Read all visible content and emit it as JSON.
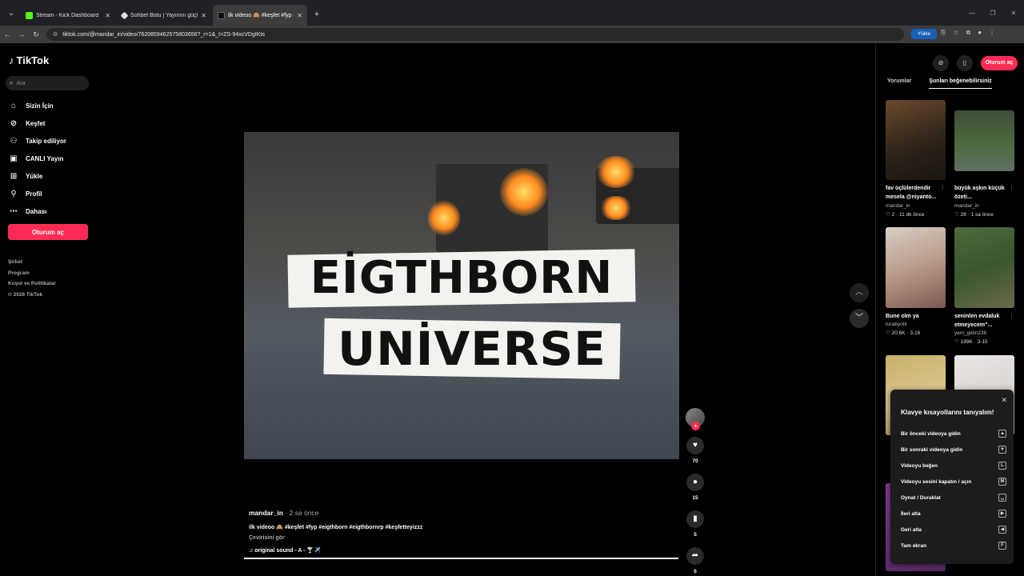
{
  "browser": {
    "tabs": [
      {
        "title": "Stream - Kick Dashboard",
        "favicon_color": "#53fc18"
      },
      {
        "title": "Sohbet Botu | Yayınını güçlendi",
        "favicon_color": "#e0e0e0"
      },
      {
        "title": "ilk videoo 🙈 #keşfet #fyp #eig",
        "favicon_color": "#111111"
      }
    ],
    "url": "tiktok.com/@mandar_in/video/7620859462575803656?_r=1&_t=ZS-94xcVDgIKts",
    "upload_pill": "Yükle"
  },
  "sidebar": {
    "logo": "TikTok",
    "search_placeholder": "Ara",
    "nav": [
      {
        "label": "Sizin İçin",
        "icon": "home-icon"
      },
      {
        "label": "Keşfet",
        "icon": "compass-icon"
      },
      {
        "label": "Takip ediliyor",
        "icon": "following-icon"
      },
      {
        "label": "CANLI Yayın",
        "icon": "live-icon"
      },
      {
        "label": "Yükle",
        "icon": "upload-icon"
      },
      {
        "label": "Profil",
        "icon": "profile-icon"
      },
      {
        "label": "Dahası",
        "icon": "more-icon"
      }
    ],
    "login": "Oturum aç",
    "footer": [
      "Şirket",
      "Program",
      "Koşul ve Politikalar",
      "© 2026 TikTok"
    ]
  },
  "video": {
    "title_line1": "EİGTHBORN",
    "title_line2": "UNİVERSE",
    "author": "mandar_in",
    "ago": " · 2 sa önce",
    "caption": "ilk videoo 🙈 #keşfet #fyp #eigthborn #eigthbornrp #keşfetteyizzz",
    "translate": "Çevirisini gör",
    "sound": "♫  original sound - A - 🍸✈️",
    "progress": 1.0
  },
  "actions": {
    "likes": "70",
    "comments": "15",
    "saves": "5",
    "shares": "6"
  },
  "right_panel": {
    "login": "Oturum aç",
    "tabs": [
      "Yorumlar",
      "Şunları beğenebilirsiniz"
    ],
    "cards": [
      {
        "title": "fav üçlülerdendir mesela @niyanto...",
        "author": "mandar_in",
        "stats": "♡ 2 · 11 dk önce"
      },
      {
        "title": "büyük aşkın küçük özeti...",
        "author": "mandar_in",
        "stats": "♡ 28 · 1 sa önce"
      },
      {
        "title": "Bune olm ya",
        "author": "turabyotk",
        "stats": "♡ 20.6K · 3-16"
      },
      {
        "title": "seninlen evdaluk etmeyecem\"...",
        "author": "yeni_gelin238",
        "stats": "♡ 189K · 3-15"
      }
    ]
  },
  "keyboard_popup": {
    "title": "Klavye kısayollarını tanıyalım!",
    "rows": [
      {
        "label": "Bir önceki videoya gidin",
        "key": "▲"
      },
      {
        "label": "Bir sonraki videoya gidin",
        "key": "▼"
      },
      {
        "label": "Videoyu beğen",
        "key": "L"
      },
      {
        "label": "Videoyu sesini kapatın / açın",
        "key": "M"
      },
      {
        "label": "Oynat / Duraklat",
        "key": "␣"
      },
      {
        "label": "İleri atla",
        "key": "▶"
      },
      {
        "label": "Geri atla",
        "key": "◀"
      },
      {
        "label": "Tam ekran",
        "key": "F"
      }
    ]
  }
}
